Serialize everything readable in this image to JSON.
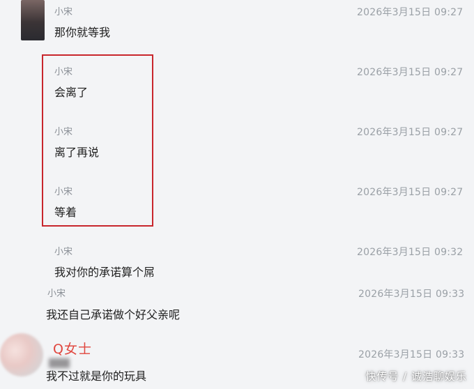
{
  "messages": [
    {
      "sender": "小宋",
      "time": "2026年3月15日 09:27",
      "text": "那你就等我"
    },
    {
      "sender": "小宋",
      "time": "2026年3月15日 09:27",
      "text": "会离了"
    },
    {
      "sender": "小宋",
      "time": "2026年3月15日 09:27",
      "text": "离了再说"
    },
    {
      "sender": "小宋",
      "time": "2026年3月15日 09:27",
      "text": "等着"
    },
    {
      "sender": "小宋",
      "time": "2026年3月15日 09:32",
      "text": "我对你的承诺算个屌"
    },
    {
      "sender": "小宋",
      "time": "2026年3月15日 09:33",
      "text": "我还自己承诺做个好父亲呢"
    },
    {
      "sender": "Q女士",
      "time": "2026年3月15日 09:33",
      "text": "我不过就是你的玩具"
    }
  ],
  "watermark": "快传号 / 诚浩聊娱乐",
  "colors": {
    "highlight": "#c8262c",
    "q_name": "#e0473f"
  }
}
